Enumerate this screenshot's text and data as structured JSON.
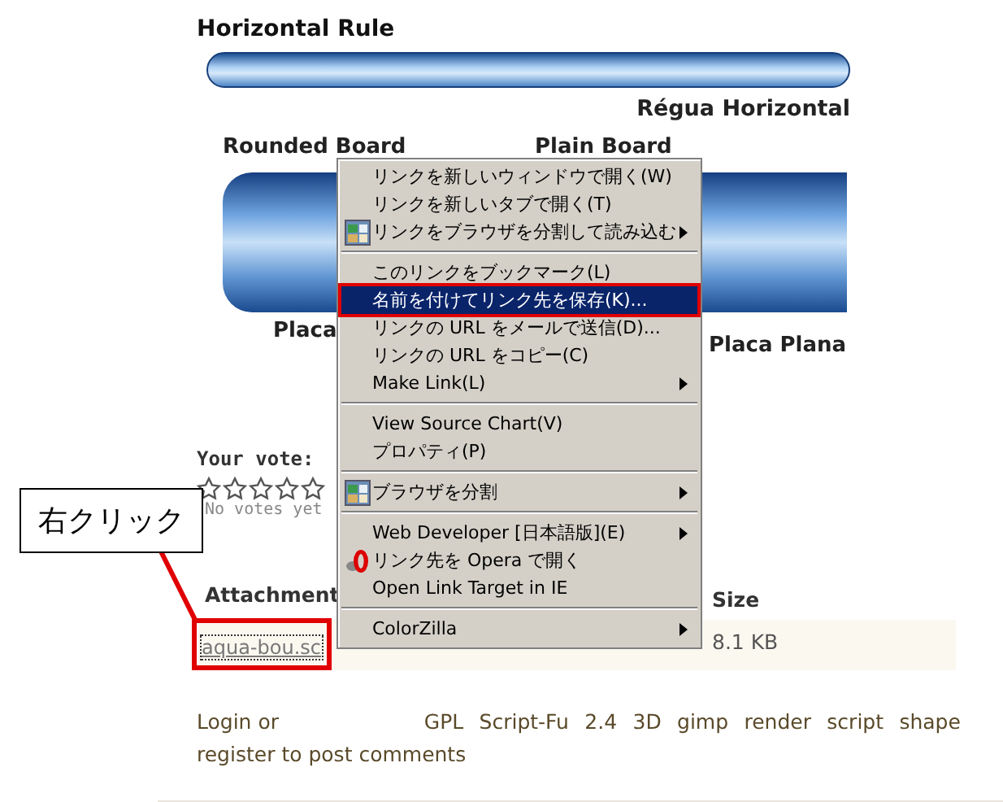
{
  "horizontal_rule": {
    "title": "Horizontal Rule",
    "caption": "Régua Horizontal"
  },
  "boards": [
    {
      "kind": "rounded",
      "title": "Rounded Board",
      "caption": "Placa"
    },
    {
      "kind": "plain",
      "title": "Plain Board",
      "caption": "Placa Plana"
    }
  ],
  "vote": {
    "label": "Your vote:",
    "stars": 0,
    "note": "No votes yet"
  },
  "attachments": {
    "columns": [
      "Attachment",
      "Size"
    ],
    "rows": [
      {
        "file": "aqua-bou.sc",
        "size": "8.1 KB"
      }
    ]
  },
  "footer": {
    "login": "Login",
    "or": "or",
    "register": "register",
    "rest": "to post comments",
    "tags": [
      "GPL",
      "Script-Fu",
      "2.4",
      "3D",
      "gimp",
      "render",
      "script",
      "shape"
    ]
  },
  "context_menu": {
    "items": [
      {
        "kind": "item",
        "label": "リンクを新しいウィンドウで開く(W)",
        "submenu": false,
        "selected": false
      },
      {
        "kind": "item",
        "label": "リンクを新しいタブで開く(T)",
        "submenu": false,
        "selected": false
      },
      {
        "kind": "split-item",
        "label": "リンクをブラウザを分割して読み込む",
        "submenu": true,
        "selected": false
      },
      {
        "kind": "separator"
      },
      {
        "kind": "item",
        "label": "このリンクをブックマーク(L)",
        "submenu": false,
        "selected": false
      },
      {
        "kind": "item",
        "label": "名前を付けてリンク先を保存(K)...",
        "submenu": false,
        "selected": true
      },
      {
        "kind": "item",
        "label": "リンクの URL をメールで送信(D)...",
        "submenu": false,
        "selected": false
      },
      {
        "kind": "item",
        "label": "リンクの URL をコピー(C)",
        "submenu": false,
        "selected": false
      },
      {
        "kind": "item",
        "label": "Make Link(L)",
        "submenu": true,
        "selected": false
      },
      {
        "kind": "separator"
      },
      {
        "kind": "item",
        "label": "View Source Chart(V)",
        "submenu": false,
        "selected": false
      },
      {
        "kind": "item",
        "label": "プロパティ(P)",
        "submenu": false,
        "selected": false
      },
      {
        "kind": "separator"
      },
      {
        "kind": "split-item",
        "label": "ブラウザを分割",
        "submenu": true,
        "selected": false
      },
      {
        "kind": "separator"
      },
      {
        "kind": "item",
        "label": "Web Developer [日本語版](E)",
        "submenu": true,
        "selected": false
      },
      {
        "kind": "opera-item",
        "label": "リンク先を Opera で開く",
        "submenu": false,
        "selected": false
      },
      {
        "kind": "item",
        "label": "Open Link Target in IE",
        "submenu": false,
        "selected": false
      },
      {
        "kind": "separator"
      },
      {
        "kind": "item",
        "label": "ColorZilla",
        "submenu": true,
        "selected": false
      }
    ]
  },
  "callout": {
    "text": "右クリック"
  }
}
